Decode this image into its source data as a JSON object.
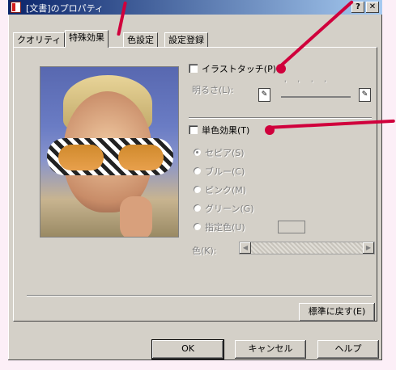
{
  "window": {
    "title": "[文書]のプロパティ",
    "help_label": "?",
    "close_label": "✕"
  },
  "tabs": [
    {
      "label": "クオリティ"
    },
    {
      "label": "特殊効果"
    },
    {
      "label": "色設定"
    },
    {
      "label": "設定登録"
    }
  ],
  "illustration": {
    "checkbox_label": "イラストタッチ(P)",
    "brightness_label": "明るさ(L):",
    "checked": false
  },
  "monochrome": {
    "checkbox_label": "単色効果(T)",
    "checked": false,
    "options": [
      {
        "label": "セピア(S)"
      },
      {
        "label": "ブルー(C)"
      },
      {
        "label": "ピンク(M)"
      },
      {
        "label": "グリーン(G)"
      },
      {
        "label": "指定色(U)"
      }
    ],
    "selected_index": 0,
    "color_label": "色(K):",
    "scroll_left": "◀",
    "scroll_right": "▶"
  },
  "buttons": {
    "reset": "標準に戻す(E)",
    "ok": "OK",
    "cancel": "キャンセル",
    "help": "ヘルプ"
  },
  "colors": {
    "title_bar": "#0A246A",
    "dialog_face": "#D4D0C8",
    "pointer": "#D0003C",
    "page_background": "#FCEFF7"
  }
}
